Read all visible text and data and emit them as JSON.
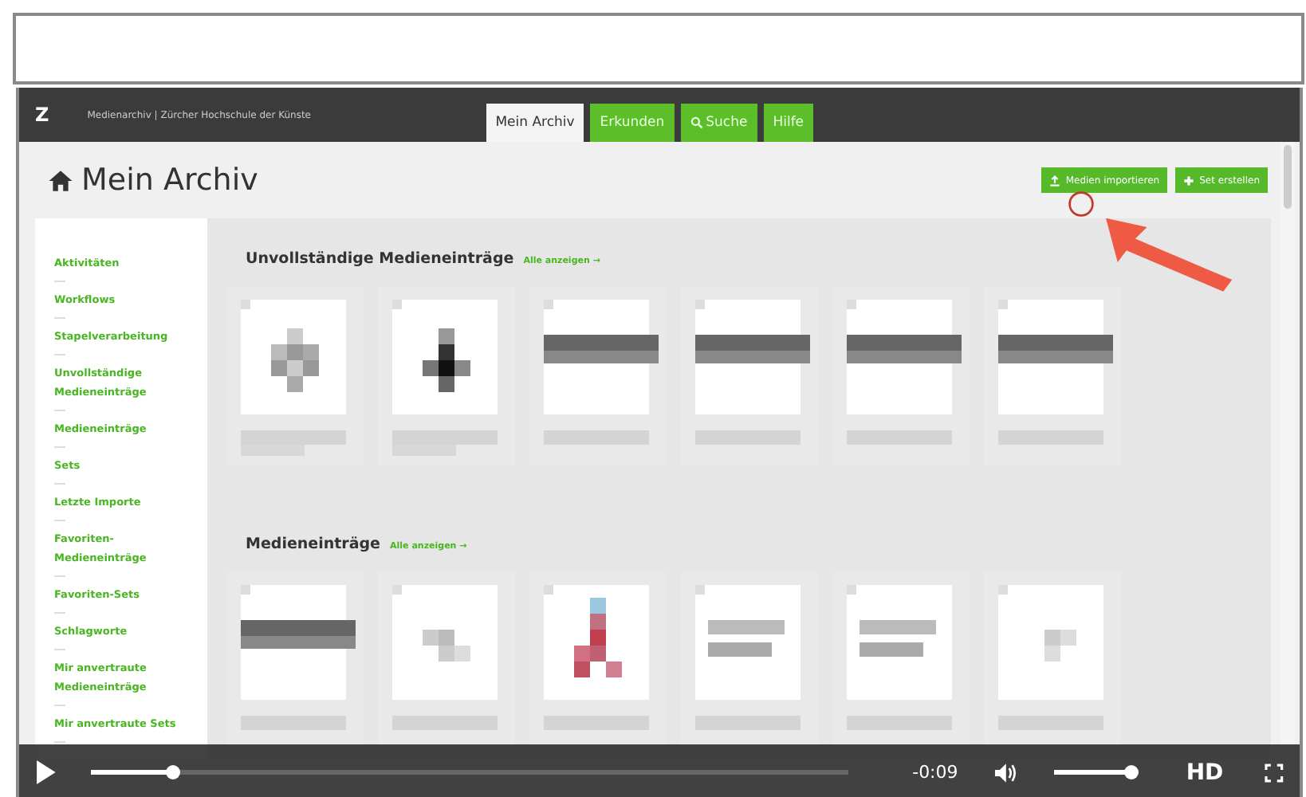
{
  "video": {
    "app": {
      "logo": "Z",
      "site_title": "Medienarchiv | Zürcher Hochschule der Künste",
      "tabs": [
        {
          "label": "Mein Archiv",
          "kind": "plain",
          "selected": true
        },
        {
          "label": "Erkunden",
          "kind": "plain",
          "selected": false
        },
        {
          "label": "Suche",
          "kind": "search",
          "selected": false
        },
        {
          "label": "Hilfe",
          "kind": "plain",
          "selected": false
        }
      ],
      "page_title": "Mein Archiv",
      "actions": [
        {
          "label": "Medien importieren",
          "kind": "upload"
        },
        {
          "label": "Set erstellen",
          "kind": "create"
        }
      ],
      "sidebar": [
        "Aktivitäten",
        "Workflows",
        "Stapelverarbeitung",
        "Unvollständige Medieneinträge",
        "Medieneinträge",
        "Sets",
        "Letzte Importe",
        "Favoriten-Medieneinträge",
        "Favoriten-Sets",
        "Schlagworte",
        "Mir anvertraute Medieneinträge",
        "Mir anvertraute Sets"
      ],
      "sections": [
        {
          "title": "Unvollständige Medieneinträge",
          "link": "Alle anzeigen →"
        },
        {
          "title": "Medieneinträge",
          "link": "Alle anzeigen →"
        }
      ]
    },
    "controls": {
      "playing": false,
      "progress": {
        "level": 0.11
      },
      "time": "-0:09",
      "volume": {
        "level": 0.97
      },
      "quality": "HD"
    }
  }
}
